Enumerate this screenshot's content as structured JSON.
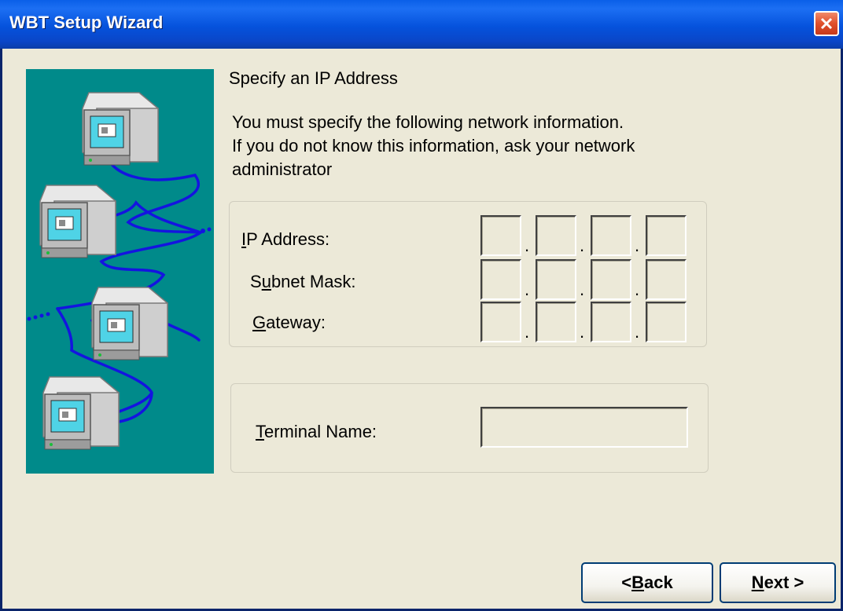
{
  "window": {
    "title": "WBT Setup Wizard"
  },
  "page": {
    "heading": "Specify an IP Address",
    "description_lines": [
      "You must specify the following network information.",
      "If you do not know this information, ask your network",
      "administrator"
    ]
  },
  "network": {
    "ip_label": {
      "mnemonic": "I",
      "rest": "P Address:"
    },
    "subnet_label": {
      "before": "S",
      "mnemonic": "u",
      "rest": "bnet Mask:"
    },
    "gateway_label": {
      "mnemonic": "G",
      "rest": "ateway:"
    },
    "ip_address": [
      "",
      "",
      "",
      ""
    ],
    "subnet_mask": [
      "",
      "",
      "",
      ""
    ],
    "gateway": [
      "",
      "",
      "",
      ""
    ],
    "separator": "."
  },
  "terminal": {
    "label": {
      "mnemonic": "T",
      "rest": "erminal Name:"
    },
    "value": ""
  },
  "buttons": {
    "back": {
      "prefix": "< ",
      "mnemonic": "B",
      "rest": "ack"
    },
    "next": {
      "mnemonic": "N",
      "rest": "ext >"
    }
  },
  "colors": {
    "art_background": "#008a8a",
    "cable": "#1414e0",
    "title_bar": "#0552dc"
  }
}
